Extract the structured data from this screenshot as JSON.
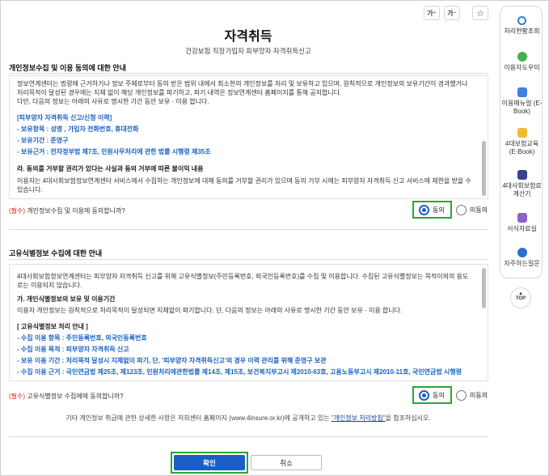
{
  "toolbar": {
    "font_increase_label": "가⁺",
    "font_decrease_label": "가⁻",
    "star_label": "☆"
  },
  "page": {
    "title": "자격취득",
    "subtitle": "건강보험 직장가입자 피부양자 자격취득신고"
  },
  "privacy_section": {
    "title": "개인정보수집 및 이용 동의에 대한 안내",
    "intro_1": "정보연계센터는 법령에 근거하거나 정보 주체로부터 동의 받은 범위 내에서 최소한의 개인정보를 처리 및 보유하고 있으며, 원칙적으로 개인정보의 보유기간이 경과했거나 처리목적이 달성된 경우에는 지체 없이 해당 개인정보를 파기하고, 파기 내역은 정보연계센터 홈페이지를 통해 공지합니다.",
    "intro_2": "다만, 다음의 정보는 아래의 사유로 명시한 기간 동안 보유 · 이용 합니다.",
    "block_title": "[피부양자 자격취득 신고/신청 이력]",
    "items": [
      "- 보유항목 : 성명 , 가입자 전화번호, 휴대전화",
      "- 보유기간 : 준영구",
      "- 보유근거 : 전자정부법 제7조, 민원사무처리에 관한 법률 시행령 제35조"
    ],
    "refusal_title": "라. 동의를 거부할 권리가 있다는 사실과 동의 거부에 따른 불이익 내용",
    "refusal_text": "이용자는 4대사회보험정보연계센터 서비스에서 수집하는 개인정보에 대해 동의를 거부할 권리가 있으며 동의 거부 시에는 피부양자 자격취득 신고 서비스에 제한을 받을 수 있습니다.",
    "question_required": "(필수)",
    "question": " 개인정보수집 및 이용에 동의합니까?",
    "agree_label": "동의",
    "disagree_label": "미동의",
    "selected": "agree"
  },
  "unique_id_section": {
    "title": "고유식별정보 수집에 대한 안내",
    "intro": "4대사회보험정보연계센터는 피부양자 자격취득 신고를 위해 고유식별정보(주민등록번호, 외국인등록번호)를 수집 및 이용합니다. 수집된 고유식별정보는 목적이외의 용도로는 이용되지 않습니다.",
    "retention_title": "가. 개인식별정보의 보유 및 이용기간",
    "retention_text": "이용자 개인정보는 원칙적으로 처리목적이 달성되면 지체없이 파기합니다. 단, 다음의 정보는 아래의 사유로 명시한 기간 동안 보유 · 이용 합니다.",
    "block_title": "[ 고유식별정보 처리 안내 ]",
    "items": [
      "- 수집 이용 항목 : 주민등록번호, 외국인등록번호",
      "- 수집 이용 목적 : 피부양자 자격취득 신고",
      "- 보유 이용 기간 : 처리목적 달성시 지체없이 파기, 단, '피부양자 자격취득신고'의 경우 이력 관리를 위해 준영구 보관",
      "- 수집 이용 근거 : 국민연금법 제25조, 제123조, 민원처리에관한법률 제14조, 제15조, 보건복지부고시 제2010-63호, 고용노동부고시 제2010-11호, 국민연금법 시행령"
    ],
    "question_required": "(필수)",
    "question": " 고유식별정보 수집에에 동의합니까?",
    "agree_label": "동의",
    "disagree_label": "미동의",
    "selected": "agree"
  },
  "footer": {
    "note_before": "기타 개인정보 취급에 관한 상세한 사항은 저희센터 홈페이지 (www.4insure.or.kr)에 공개하고 있는 ",
    "note_link": "\"개인정보 처리방침\"",
    "note_after": "을 참조하십시오.",
    "confirm_label": "확인",
    "cancel_label": "취소"
  },
  "sidebar": {
    "items": [
      {
        "label": "처리현황조회",
        "icon": "search-icon",
        "color": "#2e7fd9"
      },
      {
        "label": "이용자도우미",
        "icon": "chat-helper-icon",
        "color": "#43b14a"
      },
      {
        "label": "이용매뉴얼 (E-Book)",
        "icon": "help-book-icon",
        "color": "#3f7fe0"
      },
      {
        "label": "4대보험교육 (E-Book)",
        "icon": "education-book-icon",
        "color": "#f2b931"
      },
      {
        "label": "4대사회보험료 계산기",
        "icon": "calculator-icon",
        "color": "#3b3f8f"
      },
      {
        "label": "서식자료실",
        "icon": "folder-icon",
        "color": "#8a63c8"
      },
      {
        "label": "자주하는질문",
        "icon": "faq-icon",
        "color": "#2c6fcf"
      }
    ],
    "top_label": "TOP"
  },
  "colors": {
    "primary": "#1b5fc6",
    "link_blue": "#1a63c2",
    "required_red": "#d21f1f",
    "highlight_green": "#2ea52e"
  }
}
